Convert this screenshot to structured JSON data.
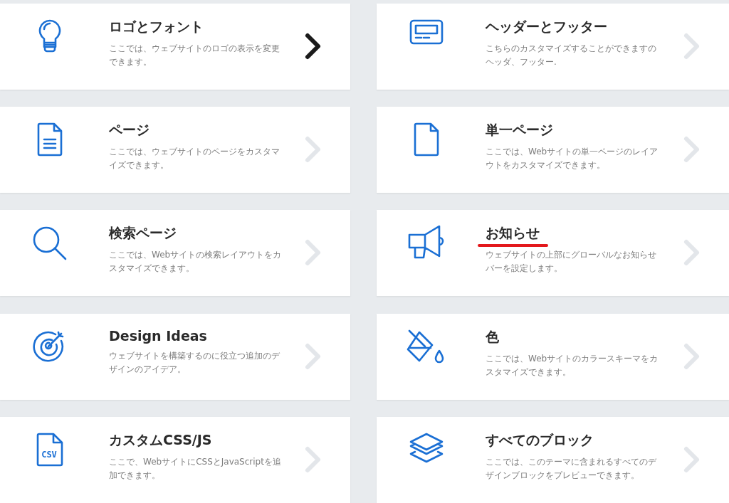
{
  "cards": [
    {
      "kind": "bulb",
      "title": "ロゴとフォント",
      "description": "ここでは、ウェブサイトのロゴの表示を変更できます。",
      "arrow_highlighted": true,
      "underlined": false
    },
    {
      "kind": "header",
      "title": "ヘッダーとフッター",
      "description": "こちらのカスタマイズすることができますのヘッダ、フッター.",
      "arrow_highlighted": false,
      "underlined": false
    },
    {
      "kind": "document",
      "title": "ページ",
      "description": "ここでは、ウェブサイトのページをカスタマイズできます。",
      "arrow_highlighted": false,
      "underlined": false
    },
    {
      "kind": "page",
      "title": "単一ページ",
      "description": "ここでは、Webサイトの単一ページのレイアウトをカスタマイズできます。",
      "arrow_highlighted": false,
      "underlined": false
    },
    {
      "kind": "search",
      "title": "検索ページ",
      "description": "ここでは、Webサイトの検索レイアウトをカスタマイズできます。",
      "arrow_highlighted": false,
      "underlined": false
    },
    {
      "kind": "megaphone",
      "title": "お知らせ",
      "description": "ウェブサイトの上部にグローバルなお知らせバーを設定します。",
      "arrow_highlighted": false,
      "underlined": true
    },
    {
      "kind": "target",
      "title": "Design Ideas",
      "description": "ウェブサイトを構築するのに役立つ追加のデザインのアイデア。",
      "arrow_highlighted": false,
      "underlined": false
    },
    {
      "kind": "paint",
      "title": "色",
      "description": "ここでは、Webサイトのカラースキーマをカスタマイズできます。",
      "arrow_highlighted": false,
      "underlined": false
    },
    {
      "kind": "csv",
      "icon_text": "CSV",
      "title": "カスタムCSS/JS",
      "description": "ここで、WebサイトにCSSとJavaScriptを追加できます。",
      "arrow_highlighted": false,
      "underlined": false
    },
    {
      "kind": "layers",
      "title": "すべてのブロック",
      "description": "ここでは、このテーマに含まれるすべてのデザインブロックをプレビューできます。",
      "arrow_highlighted": false,
      "underlined": false
    }
  ]
}
